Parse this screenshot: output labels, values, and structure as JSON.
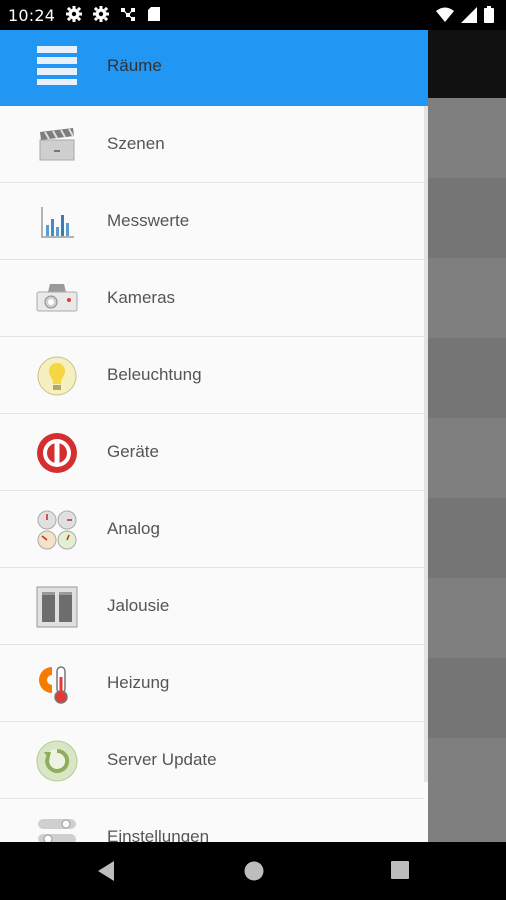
{
  "status_bar": {
    "time": "10:24",
    "left_icons": [
      "gear-icon",
      "gear-icon",
      "network-icon",
      "sd-card-icon"
    ],
    "right_icons": [
      "wifi-icon",
      "signal-icon",
      "battery-icon"
    ]
  },
  "drawer": {
    "header": {
      "label": "Räume",
      "icon": "hamburger-menu-icon",
      "color": "#2196f3"
    },
    "items": [
      {
        "label": "Szenen",
        "icon": "clapperboard-icon"
      },
      {
        "label": "Messwerte",
        "icon": "bar-chart-icon"
      },
      {
        "label": "Kameras",
        "icon": "camera-icon"
      },
      {
        "label": "Beleuchtung",
        "icon": "lightbulb-icon"
      },
      {
        "label": "Geräte",
        "icon": "power-icon"
      },
      {
        "label": "Analog",
        "icon": "gauges-icon"
      },
      {
        "label": "Jalousie",
        "icon": "window-blinds-icon"
      },
      {
        "label": "Heizung",
        "icon": "thermometer-icon"
      },
      {
        "label": "Server Update",
        "icon": "refresh-icon"
      },
      {
        "label": "Einstellungen",
        "icon": "settings-sliders-icon"
      }
    ]
  },
  "nav_bar": {
    "buttons": [
      "back-icon",
      "home-icon",
      "recents-icon"
    ]
  }
}
